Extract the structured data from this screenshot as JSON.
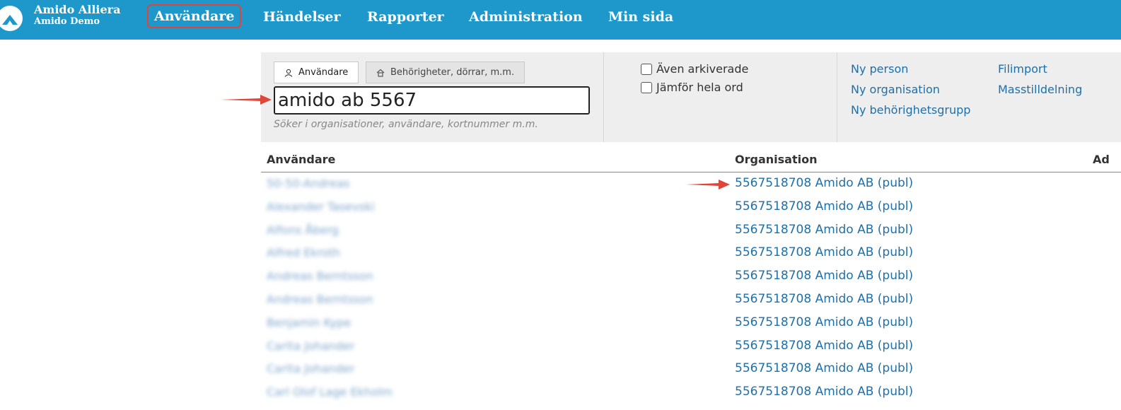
{
  "brand": {
    "title": "Amido Alliera",
    "subtitle": "Amido Demo"
  },
  "nav": {
    "users": "Användare",
    "events": "Händelser",
    "reports": "Rapporter",
    "admin": "Administration",
    "mypage": "Min sida"
  },
  "tabs": {
    "users": "Användare",
    "permissions": "Behörigheter, dörrar, m.m."
  },
  "search": {
    "value": "amido ab 5567",
    "hint": "Söker i organisationer, användare, kortnummer m.m."
  },
  "options": {
    "archived": "Även arkiverade",
    "whole_words": "Jämför hela ord"
  },
  "actions": {
    "new_person": "Ny person",
    "new_org": "Ny organisation",
    "new_group": "Ny behörighetsgrupp",
    "file_import": "Filimport",
    "mass_assign": "Masstilldelning"
  },
  "table": {
    "headers": {
      "user": "Användare",
      "org": "Organisation",
      "third": "Ad"
    },
    "rows": [
      {
        "user": "50-50-Andreas",
        "org": "5567518708 Amido AB (publ)"
      },
      {
        "user": "Alexander Tasevski",
        "org": "5567518708 Amido AB (publ)"
      },
      {
        "user": "Alfons Åberg",
        "org": "5567518708 Amido AB (publ)"
      },
      {
        "user": "Alfred Ekroth",
        "org": "5567518708 Amido AB (publ)"
      },
      {
        "user": "Andreas Berntsson",
        "org": "5567518708 Amido AB (publ)"
      },
      {
        "user": "Andreas Berntsson",
        "org": "5567518708 Amido AB (publ)"
      },
      {
        "user": "Benjamin Kype",
        "org": "5567518708 Amido AB (publ)"
      },
      {
        "user": "Carita Johander",
        "org": "5567518708 Amido AB (publ)"
      },
      {
        "user": "Carita Johander",
        "org": "5567518708 Amido AB (publ)"
      },
      {
        "user": "Carl Olof Lage Ekholm",
        "org": "5567518708 Amido AB (publ)"
      }
    ]
  },
  "colors": {
    "topbar": "#1e97cb",
    "link": "#1f6fa8",
    "highlight": "#e0453a"
  }
}
